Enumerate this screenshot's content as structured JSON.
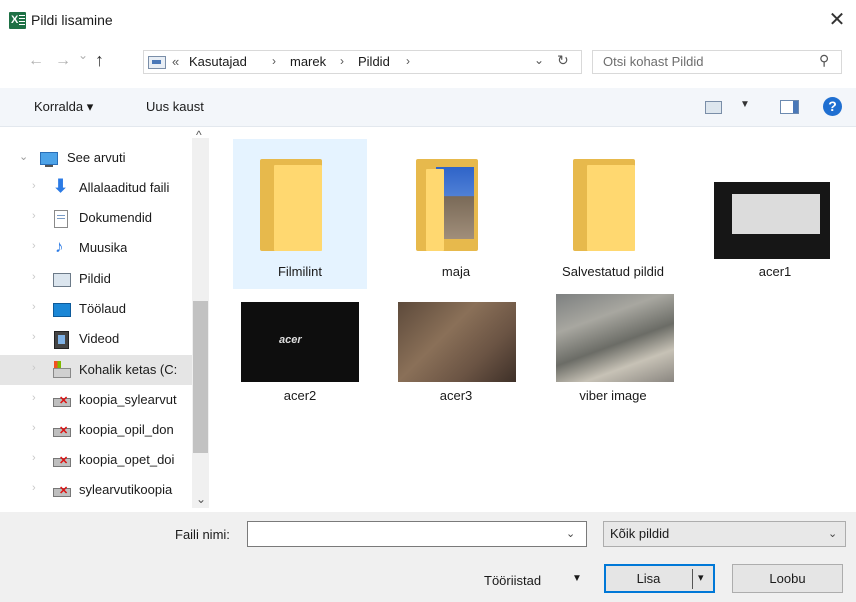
{
  "window": {
    "title": "Pildi lisamine",
    "close_glyph": "✕"
  },
  "nav": {
    "back_glyph": "←",
    "forward_glyph": "→",
    "recent_glyph": "⌄",
    "up_glyph": "↑",
    "overflow_glyph": "«",
    "breadcrumbs": [
      "Kasutajad",
      "marek",
      "Pildid"
    ],
    "separator": "›",
    "dropdown_glyph": "⌄",
    "refresh_glyph": "↻"
  },
  "search": {
    "placeholder": "Otsi kohast Pildid",
    "icon_glyph": "⚲"
  },
  "toolbar": {
    "organize_label": "Korralda ▾",
    "new_folder_label": "Uus kaust",
    "view_caret": "▼",
    "help_glyph": "?"
  },
  "sidebar": {
    "scroll_up": "^",
    "scroll_down": "⌄",
    "items": [
      {
        "label": "See arvuti",
        "icon": "computer-icon",
        "expanded": true
      },
      {
        "label": "Allalaaditud faili",
        "icon": "downloads-icon"
      },
      {
        "label": "Dokumendid",
        "icon": "documents-icon"
      },
      {
        "label": "Muusika",
        "icon": "music-icon"
      },
      {
        "label": "Pildid",
        "icon": "pictures-icon"
      },
      {
        "label": "Töölaud",
        "icon": "desktop-icon"
      },
      {
        "label": "Videod",
        "icon": "videos-icon"
      },
      {
        "label": "Kohalik ketas (C:",
        "icon": "drive-icon",
        "selected": true
      },
      {
        "label": "koopia_sylearvut",
        "icon": "network-drive-icon"
      },
      {
        "label": "koopia_opil_don",
        "icon": "network-drive-icon"
      },
      {
        "label": "koopia_opet_doi",
        "icon": "network-drive-icon"
      },
      {
        "label": "sylearvutikoopia",
        "icon": "network-drive-icon"
      }
    ]
  },
  "files": [
    {
      "name": "Filmilint",
      "type": "folder",
      "selected": true
    },
    {
      "name": "maja",
      "type": "folder-with-photo"
    },
    {
      "name": "Salvestatud pildid",
      "type": "folder"
    },
    {
      "name": "acer1",
      "type": "image"
    },
    {
      "name": "acer2",
      "type": "image",
      "thumb_text": "acer"
    },
    {
      "name": "acer3",
      "type": "image"
    },
    {
      "name": "viber image",
      "type": "image"
    }
  ],
  "footer": {
    "filename_label": "Faili nimi:",
    "filename_value": "",
    "dropdown_glyph": "⌄",
    "filter_value": "Kõik pildid",
    "tools_label": "Tööriistad",
    "tools_caret": "▼",
    "insert_label": "Lisa",
    "insert_caret": "▾",
    "cancel_label": "Loobu"
  },
  "colors": {
    "accent": "#0078d7",
    "selection": "#e5f3ff",
    "folder": "#ffd870"
  }
}
